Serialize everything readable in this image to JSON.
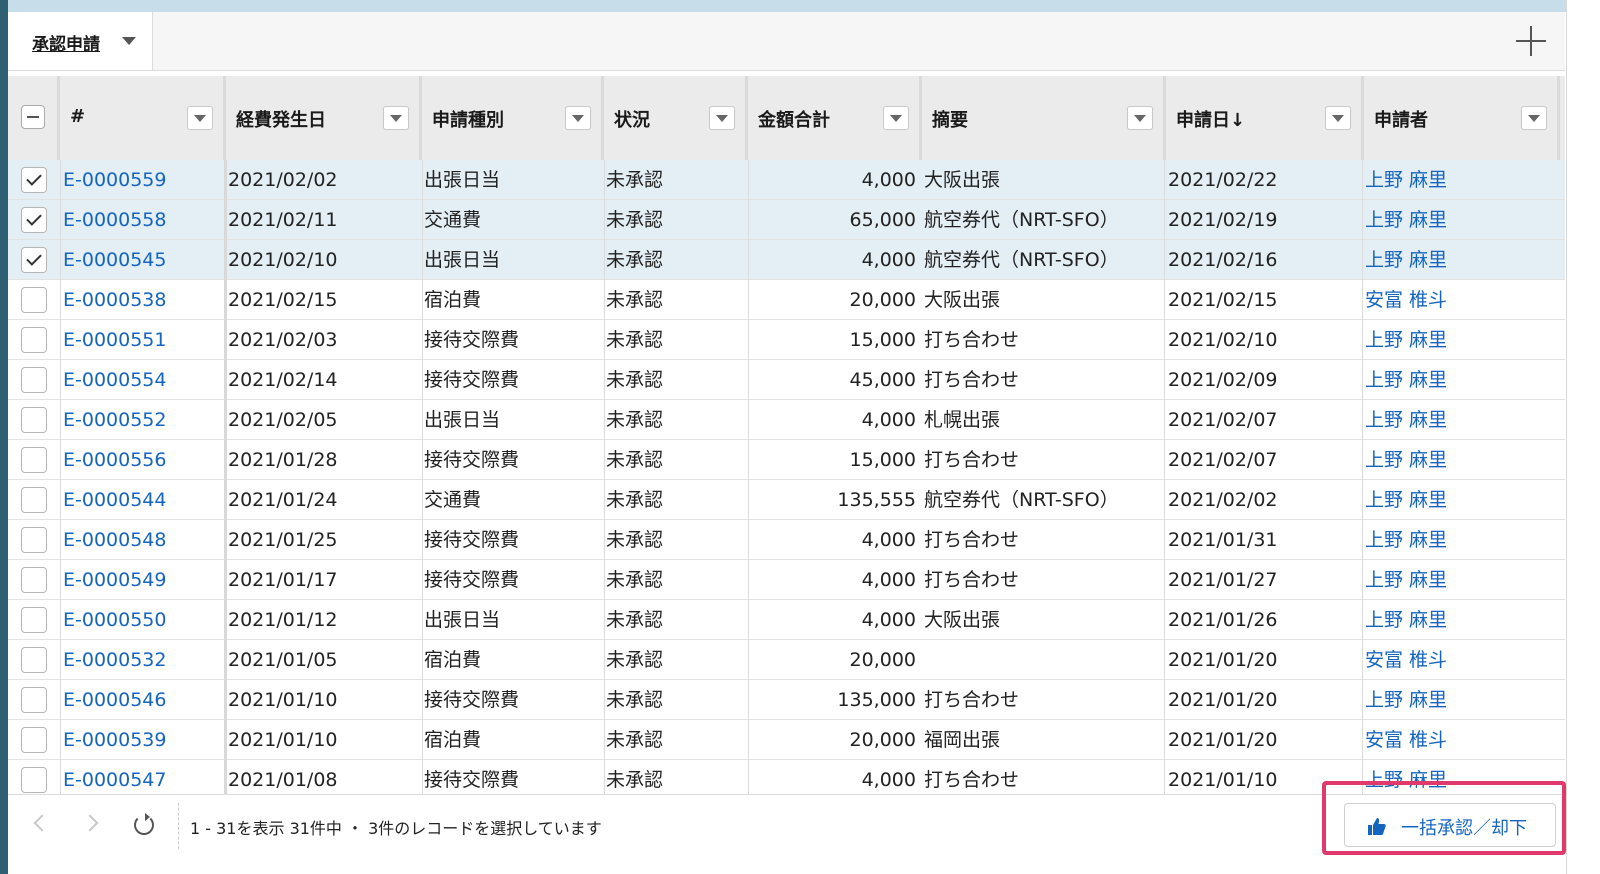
{
  "tab": {
    "label": "承認申請"
  },
  "columns": [
    "#",
    "経費発生日",
    "申請種別",
    "状況",
    "金額合計",
    "摘要",
    "申請日↓",
    "申請者"
  ],
  "rows": [
    {
      "selected": true,
      "id": "E-0000559",
      "date": "2021/02/02",
      "type": "出張日当",
      "status": "未承認",
      "amount": "4,000",
      "memo": "大阪出張",
      "applied": "2021/02/22",
      "applicant": "上野 麻里"
    },
    {
      "selected": true,
      "id": "E-0000558",
      "date": "2021/02/11",
      "type": "交通費",
      "status": "未承認",
      "amount": "65,000",
      "memo": "航空券代（NRT-SFO）",
      "applied": "2021/02/19",
      "applicant": "上野 麻里"
    },
    {
      "selected": true,
      "id": "E-0000545",
      "date": "2021/02/10",
      "type": "出張日当",
      "status": "未承認",
      "amount": "4,000",
      "memo": "航空券代（NRT-SFO）",
      "applied": "2021/02/16",
      "applicant": "上野 麻里"
    },
    {
      "selected": false,
      "id": "E-0000538",
      "date": "2021/02/15",
      "type": "宿泊費",
      "status": "未承認",
      "amount": "20,000",
      "memo": "大阪出張",
      "applied": "2021/02/15",
      "applicant": "安富 椎斗"
    },
    {
      "selected": false,
      "id": "E-0000551",
      "date": "2021/02/03",
      "type": "接待交際費",
      "status": "未承認",
      "amount": "15,000",
      "memo": "打ち合わせ",
      "applied": "2021/02/10",
      "applicant": "上野 麻里"
    },
    {
      "selected": false,
      "id": "E-0000554",
      "date": "2021/02/14",
      "type": "接待交際費",
      "status": "未承認",
      "amount": "45,000",
      "memo": "打ち合わせ",
      "applied": "2021/02/09",
      "applicant": "上野 麻里"
    },
    {
      "selected": false,
      "id": "E-0000552",
      "date": "2021/02/05",
      "type": "出張日当",
      "status": "未承認",
      "amount": "4,000",
      "memo": "札幌出張",
      "applied": "2021/02/07",
      "applicant": "上野 麻里"
    },
    {
      "selected": false,
      "id": "E-0000556",
      "date": "2021/01/28",
      "type": "接待交際費",
      "status": "未承認",
      "amount": "15,000",
      "memo": "打ち合わせ",
      "applied": "2021/02/07",
      "applicant": "上野 麻里"
    },
    {
      "selected": false,
      "id": "E-0000544",
      "date": "2021/01/24",
      "type": "交通費",
      "status": "未承認",
      "amount": "135,555",
      "memo": "航空券代（NRT-SFO）",
      "applied": "2021/02/02",
      "applicant": "上野 麻里"
    },
    {
      "selected": false,
      "id": "E-0000548",
      "date": "2021/01/25",
      "type": "接待交際費",
      "status": "未承認",
      "amount": "4,000",
      "memo": "打ち合わせ",
      "applied": "2021/01/31",
      "applicant": "上野 麻里"
    },
    {
      "selected": false,
      "id": "E-0000549",
      "date": "2021/01/17",
      "type": "接待交際費",
      "status": "未承認",
      "amount": "4,000",
      "memo": "打ち合わせ",
      "applied": "2021/01/27",
      "applicant": "上野 麻里"
    },
    {
      "selected": false,
      "id": "E-0000550",
      "date": "2021/01/12",
      "type": "出張日当",
      "status": "未承認",
      "amount": "4,000",
      "memo": "大阪出張",
      "applied": "2021/01/26",
      "applicant": "上野 麻里"
    },
    {
      "selected": false,
      "id": "E-0000532",
      "date": "2021/01/05",
      "type": "宿泊費",
      "status": "未承認",
      "amount": "20,000",
      "memo": "",
      "applied": "2021/01/20",
      "applicant": "安富 椎斗"
    },
    {
      "selected": false,
      "id": "E-0000546",
      "date": "2021/01/10",
      "type": "接待交際費",
      "status": "未承認",
      "amount": "135,000",
      "memo": "打ち合わせ",
      "applied": "2021/01/20",
      "applicant": "上野 麻里"
    },
    {
      "selected": false,
      "id": "E-0000539",
      "date": "2021/01/10",
      "type": "宿泊費",
      "status": "未承認",
      "amount": "20,000",
      "memo": "福岡出張",
      "applied": "2021/01/20",
      "applicant": "安富 椎斗"
    },
    {
      "selected": false,
      "id": "E-0000547",
      "date": "2021/01/08",
      "type": "接待交際費",
      "status": "未承認",
      "amount": "4,000",
      "memo": "打ち合わせ",
      "applied": "2021/01/10",
      "applicant": "上野 麻里"
    }
  ],
  "footer": {
    "status_text": "1 - 31を表示 31件中 ・ 3件のレコードを選択しています",
    "bulk_button": "一括承認／却下"
  },
  "colors": {
    "link": "#1565c0",
    "selected_row": "#e3eef5",
    "highlight": "#e0396b"
  }
}
